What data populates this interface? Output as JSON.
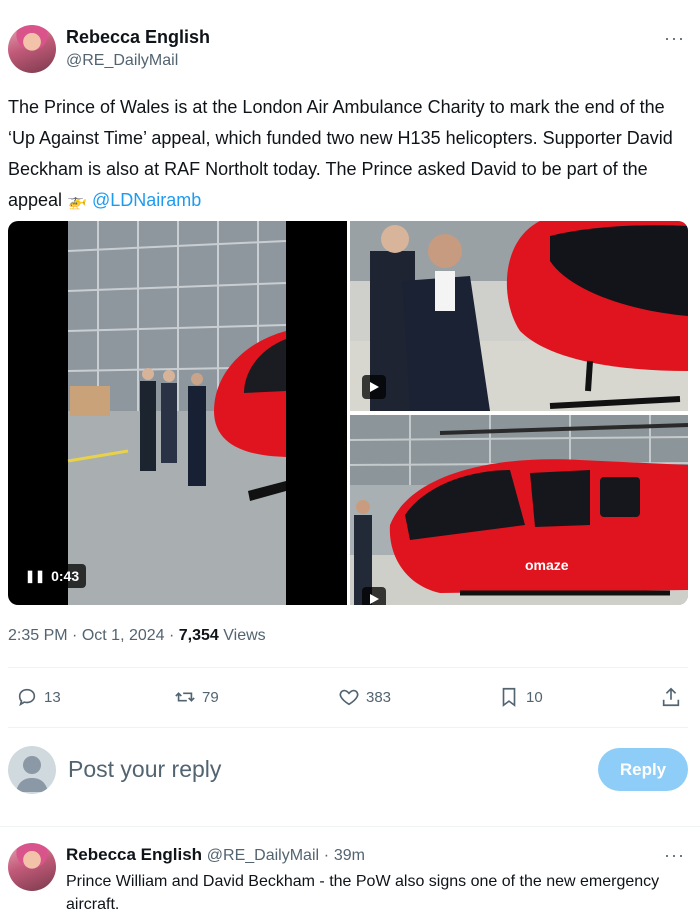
{
  "tweet": {
    "author_name": "Rebecca English",
    "author_handle": "@RE_DailyMail",
    "more_label": "···",
    "text": "The Prince of Wales is at the London Air Ambulance Charity to mark the end of the ‘Up Against Time’ appeal, which funded two new H135 helicopters. Supporter David Beckham is also at RAF Northolt today. The Prince asked David to be part of the appeal",
    "emoji": "🚁",
    "mention": "@LDNairamb",
    "media": {
      "video_duration": "0:43",
      "fuselage_text": "omaze"
    },
    "time": "2:35 PM",
    "date": "Oct 1, 2024",
    "views_count": "7,354",
    "views_label": "Views",
    "dot": "·"
  },
  "actions": {
    "replies": "13",
    "retweets": "79",
    "likes": "383",
    "bookmarks": "10"
  },
  "composer": {
    "placeholder": "Post your reply",
    "button": "Reply"
  },
  "reply": {
    "author_name": "Rebecca English",
    "author_handle": "@RE_DailyMail",
    "age": "39m",
    "dot": "·",
    "more_label": "···",
    "text": "Prince William and David Beckham - the PoW also signs one of the new emergency aircraft."
  },
  "colors": {
    "accent": "#1d9bf0",
    "reply_button": "#8ecdf7",
    "helicopter_red": "#e0141e"
  }
}
